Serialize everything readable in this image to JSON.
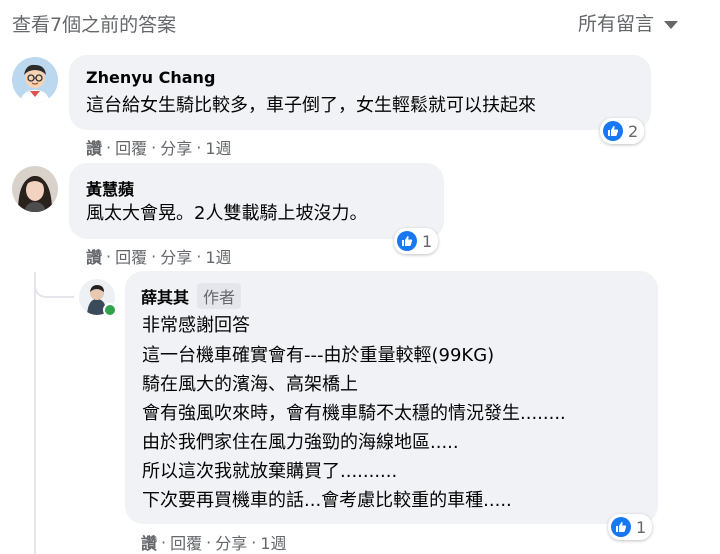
{
  "header": {
    "view_previous": "查看7個之前的答案",
    "sort_label": "所有留言"
  },
  "comments": [
    {
      "name": "Zhenyu Chang",
      "lines": [
        "這台給女生騎比較多，車子倒了，女生輕鬆就可以扶起來"
      ],
      "actions": {
        "like": "讚",
        "reply": "回覆",
        "share": "分享",
        "time": "1週"
      },
      "reaction_count": "2"
    },
    {
      "name": "黃慧蘋",
      "lines": [
        "風太大會晃。2人雙載騎上坡沒力。"
      ],
      "actions": {
        "like": "讚",
        "reply": "回覆",
        "share": "分享",
        "time": "1週"
      },
      "reaction_count": "1"
    }
  ],
  "reply": {
    "name": "薛其其",
    "badge": "作者",
    "lines": [
      "非常感謝回答",
      "這一台機車確實會有---由於重量較輕(99KG)",
      "騎在風大的濱海、高架橋上",
      "會有強風吹來時，會有機車騎不太穩的情況發生........",
      "由於我們家住在風力強勁的海線地區.....",
      "所以這次我就放棄購買了..........",
      "下次要再買機車的話...會考慮比較重的車種....."
    ],
    "actions": {
      "like": "讚",
      "reply": "回覆",
      "share": "分享",
      "time": "1週"
    },
    "reaction_count": "1"
  },
  "colors": {
    "bubble": "#f0f2f5",
    "like_blue": "#1877f2",
    "secondary_text": "#65676b",
    "online_green": "#31a24c"
  }
}
